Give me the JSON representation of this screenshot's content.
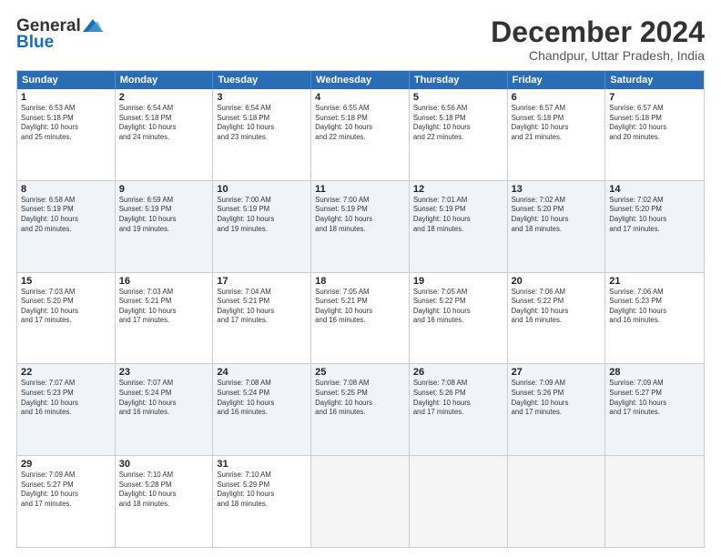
{
  "header": {
    "logo_line1": "General",
    "logo_line2": "Blue",
    "title": "December 2024",
    "subtitle": "Chandpur, Uttar Pradesh, India"
  },
  "calendar": {
    "days_of_week": [
      "Sunday",
      "Monday",
      "Tuesday",
      "Wednesday",
      "Thursday",
      "Friday",
      "Saturday"
    ],
    "weeks": [
      [
        {
          "day": "",
          "info": ""
        },
        {
          "day": "2",
          "info": "Sunrise: 6:54 AM\nSunset: 5:18 PM\nDaylight: 10 hours\nand 24 minutes."
        },
        {
          "day": "3",
          "info": "Sunrise: 6:54 AM\nSunset: 5:18 PM\nDaylight: 10 hours\nand 23 minutes."
        },
        {
          "day": "4",
          "info": "Sunrise: 6:55 AM\nSunset: 5:18 PM\nDaylight: 10 hours\nand 22 minutes."
        },
        {
          "day": "5",
          "info": "Sunrise: 6:56 AM\nSunset: 5:18 PM\nDaylight: 10 hours\nand 22 minutes."
        },
        {
          "day": "6",
          "info": "Sunrise: 6:57 AM\nSunset: 5:18 PM\nDaylight: 10 hours\nand 21 minutes."
        },
        {
          "day": "7",
          "info": "Sunrise: 6:57 AM\nSunset: 5:18 PM\nDaylight: 10 hours\nand 20 minutes."
        }
      ],
      [
        {
          "day": "1",
          "info": "Sunrise: 6:53 AM\nSunset: 5:18 PM\nDaylight: 10 hours\nand 25 minutes."
        },
        {
          "day": "9",
          "info": "Sunrise: 6:59 AM\nSunset: 5:19 PM\nDaylight: 10 hours\nand 19 minutes."
        },
        {
          "day": "10",
          "info": "Sunrise: 7:00 AM\nSunset: 5:19 PM\nDaylight: 10 hours\nand 19 minutes."
        },
        {
          "day": "11",
          "info": "Sunrise: 7:00 AM\nSunset: 5:19 PM\nDaylight: 10 hours\nand 18 minutes."
        },
        {
          "day": "12",
          "info": "Sunrise: 7:01 AM\nSunset: 5:19 PM\nDaylight: 10 hours\nand 18 minutes."
        },
        {
          "day": "13",
          "info": "Sunrise: 7:02 AM\nSunset: 5:20 PM\nDaylight: 10 hours\nand 18 minutes."
        },
        {
          "day": "14",
          "info": "Sunrise: 7:02 AM\nSunset: 5:20 PM\nDaylight: 10 hours\nand 17 minutes."
        }
      ],
      [
        {
          "day": "8",
          "info": "Sunrise: 6:58 AM\nSunset: 5:19 PM\nDaylight: 10 hours\nand 20 minutes."
        },
        {
          "day": "16",
          "info": "Sunrise: 7:03 AM\nSunset: 5:21 PM\nDaylight: 10 hours\nand 17 minutes."
        },
        {
          "day": "17",
          "info": "Sunrise: 7:04 AM\nSunset: 5:21 PM\nDaylight: 10 hours\nand 17 minutes."
        },
        {
          "day": "18",
          "info": "Sunrise: 7:05 AM\nSunset: 5:21 PM\nDaylight: 10 hours\nand 16 minutes."
        },
        {
          "day": "19",
          "info": "Sunrise: 7:05 AM\nSunset: 5:22 PM\nDaylight: 10 hours\nand 16 minutes."
        },
        {
          "day": "20",
          "info": "Sunrise: 7:06 AM\nSunset: 5:22 PM\nDaylight: 10 hours\nand 16 minutes."
        },
        {
          "day": "21",
          "info": "Sunrise: 7:06 AM\nSunset: 5:23 PM\nDaylight: 10 hours\nand 16 minutes."
        }
      ],
      [
        {
          "day": "15",
          "info": "Sunrise: 7:03 AM\nSunset: 5:20 PM\nDaylight: 10 hours\nand 17 minutes."
        },
        {
          "day": "23",
          "info": "Sunrise: 7:07 AM\nSunset: 5:24 PM\nDaylight: 10 hours\nand 16 minutes."
        },
        {
          "day": "24",
          "info": "Sunrise: 7:08 AM\nSunset: 5:24 PM\nDaylight: 10 hours\nand 16 minutes."
        },
        {
          "day": "25",
          "info": "Sunrise: 7:08 AM\nSunset: 5:25 PM\nDaylight: 10 hours\nand 16 minutes."
        },
        {
          "day": "26",
          "info": "Sunrise: 7:08 AM\nSunset: 5:26 PM\nDaylight: 10 hours\nand 17 minutes."
        },
        {
          "day": "27",
          "info": "Sunrise: 7:09 AM\nSunset: 5:26 PM\nDaylight: 10 hours\nand 17 minutes."
        },
        {
          "day": "28",
          "info": "Sunrise: 7:09 AM\nSunset: 5:27 PM\nDaylight: 10 hours\nand 17 minutes."
        }
      ],
      [
        {
          "day": "22",
          "info": "Sunrise: 7:07 AM\nSunset: 5:23 PM\nDaylight: 10 hours\nand 16 minutes."
        },
        {
          "day": "30",
          "info": "Sunrise: 7:10 AM\nSunset: 5:28 PM\nDaylight: 10 hours\nand 18 minutes."
        },
        {
          "day": "31",
          "info": "Sunrise: 7:10 AM\nSunset: 5:29 PM\nDaylight: 10 hours\nand 18 minutes."
        },
        {
          "day": "",
          "info": ""
        },
        {
          "day": "",
          "info": ""
        },
        {
          "day": "",
          "info": ""
        },
        {
          "day": "",
          "info": ""
        }
      ],
      [
        {
          "day": "29",
          "info": "Sunrise: 7:09 AM\nSunset: 5:27 PM\nDaylight: 10 hours\nand 17 minutes."
        },
        {
          "day": "",
          "info": ""
        },
        {
          "day": "",
          "info": ""
        },
        {
          "day": "",
          "info": ""
        },
        {
          "day": "",
          "info": ""
        },
        {
          "day": "",
          "info": ""
        },
        {
          "day": "",
          "info": ""
        }
      ]
    ]
  }
}
